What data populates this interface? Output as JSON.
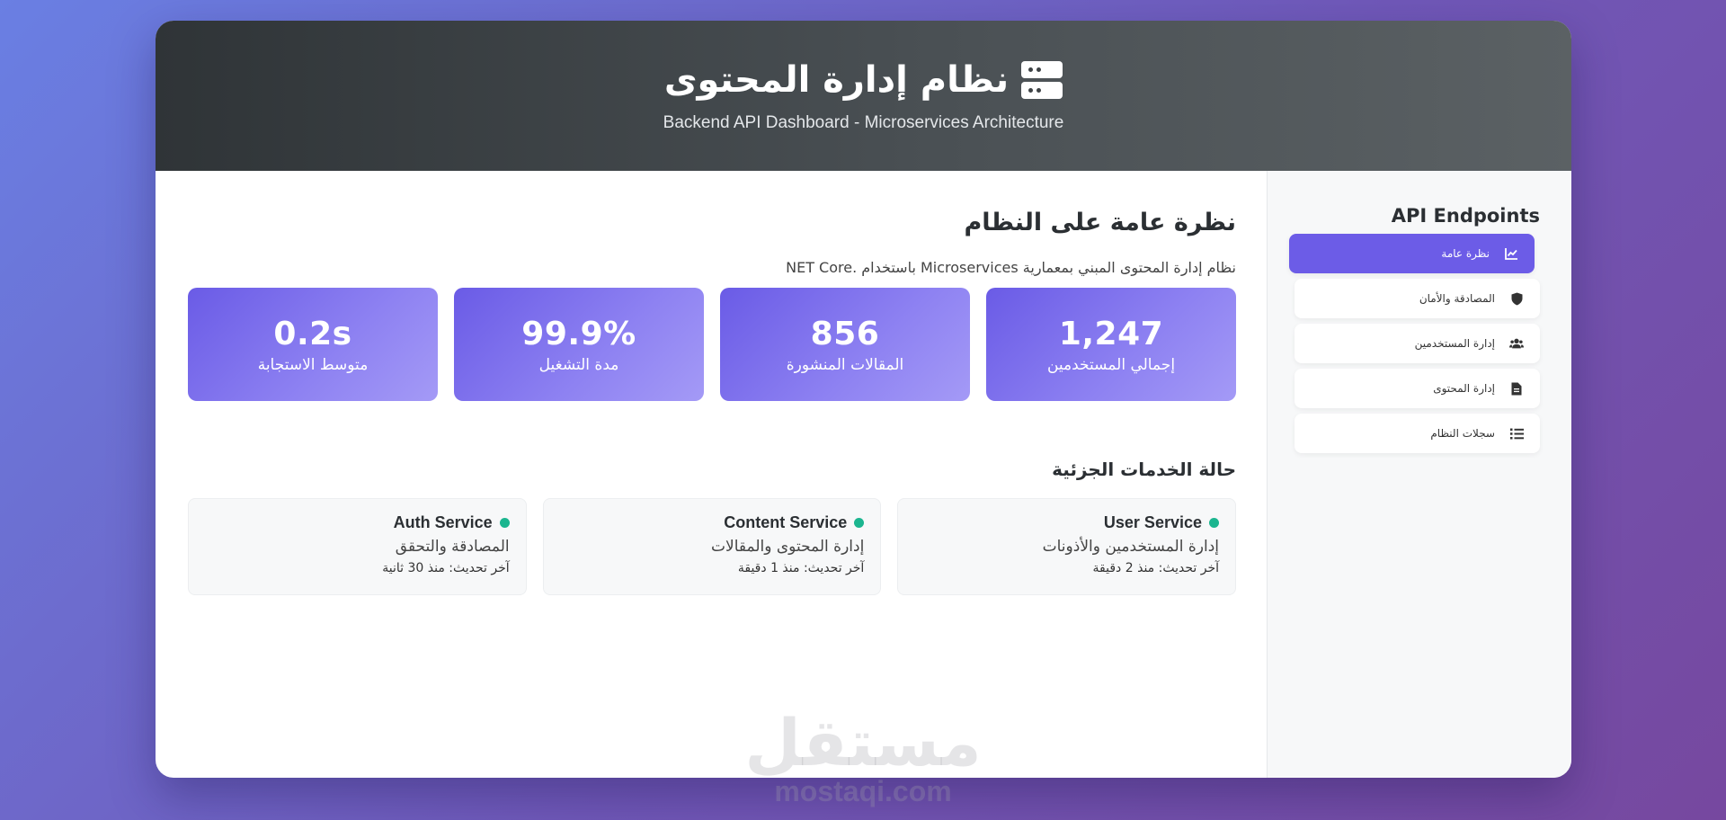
{
  "header": {
    "title": "نظام إدارة المحتوى",
    "subtitle": "Backend API Dashboard - Microservices Architecture",
    "icon": "server-icon"
  },
  "sidebar": {
    "title": "API Endpoints",
    "items": [
      {
        "label": "نظرة عامة",
        "icon": "chart-line-icon",
        "active": true
      },
      {
        "label": "المصادقة والأمان",
        "icon": "shield-icon",
        "active": false
      },
      {
        "label": "إدارة المستخدمين",
        "icon": "users-icon",
        "active": false
      },
      {
        "label": "إدارة المحتوى",
        "icon": "file-icon",
        "active": false
      },
      {
        "label": "سجلات النظام",
        "icon": "list-icon",
        "active": false
      }
    ]
  },
  "overview": {
    "title": "نظرة عامة على النظام",
    "description": "نظام إدارة المحتوى المبني بمعمارية Microservices باستخدام .NET Core"
  },
  "stats": [
    {
      "value": "1,247",
      "label": "إجمالي المستخدمين"
    },
    {
      "value": "856",
      "label": "المقالات المنشورة"
    },
    {
      "value": "99.9%",
      "label": "مدة التشغيل"
    },
    {
      "value": "0.2s",
      "label": "متوسط الاستجابة"
    }
  ],
  "services": {
    "title": "حالة الخدمات الجزئية",
    "items": [
      {
        "name": "User Service",
        "description": "إدارة المستخدمين والأذونات",
        "updated": "آخر تحديث: منذ 2 دقيقة",
        "status_color": "#1bb58f"
      },
      {
        "name": "Content Service",
        "description": "إدارة المحتوى والمقالات",
        "updated": "آخر تحديث: منذ 1 دقيقة",
        "status_color": "#1bb58f"
      },
      {
        "name": "Auth Service",
        "description": "المصادقة والتحقق",
        "updated": "آخر تحديث: منذ 30 ثانية",
        "status_color": "#1bb58f"
      }
    ]
  },
  "watermark": {
    "arabic": "مستقل",
    "latin": "mostaqi.com"
  },
  "colors": {
    "accent": "#6c5ce7",
    "header_dark": "#2f3437",
    "status_ok": "#1bb58f"
  }
}
